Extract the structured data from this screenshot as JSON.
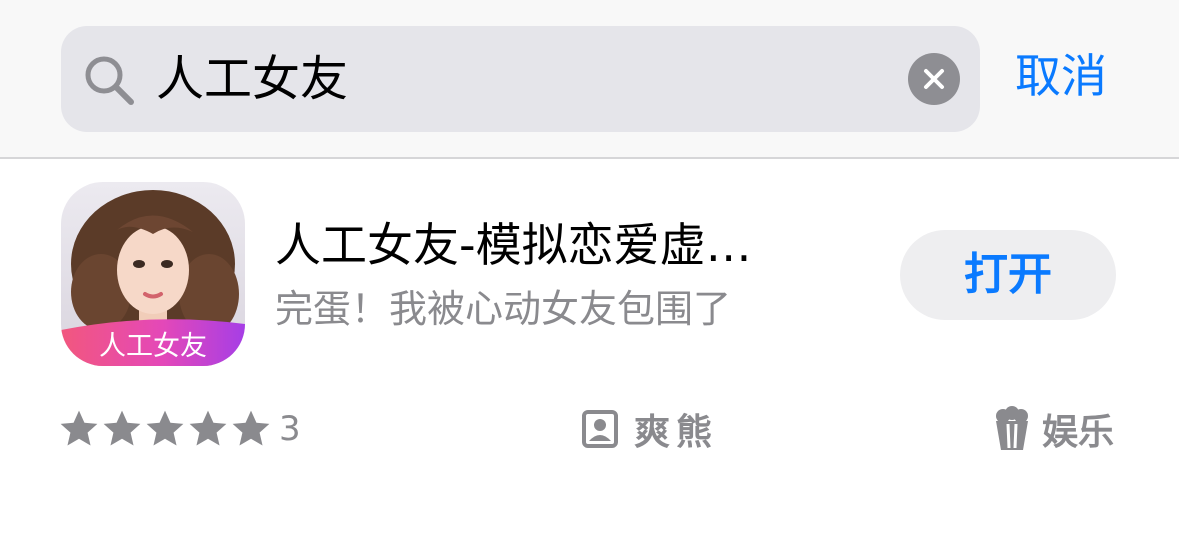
{
  "search": {
    "query": "人工女友",
    "cancel_label": "取消",
    "icon": "search-icon",
    "clear_icon": "clear-icon"
  },
  "app": {
    "title": "人工女友-模拟恋爱虚…",
    "subtitle": "完蛋！我被心动女友包围了",
    "icon_label": "人工女友",
    "action_label": "打开",
    "rating_stars": 5,
    "rating_count": "3",
    "developer": "爽熊",
    "developer_icon": "person-icon",
    "category": "娱乐",
    "category_icon": "popcorn-icon"
  },
  "colors": {
    "accent": "#0a7aff",
    "secondary_text": "#8a8a8e",
    "search_bg": "#e5e5ea",
    "button_bg": "#eeeef0"
  }
}
